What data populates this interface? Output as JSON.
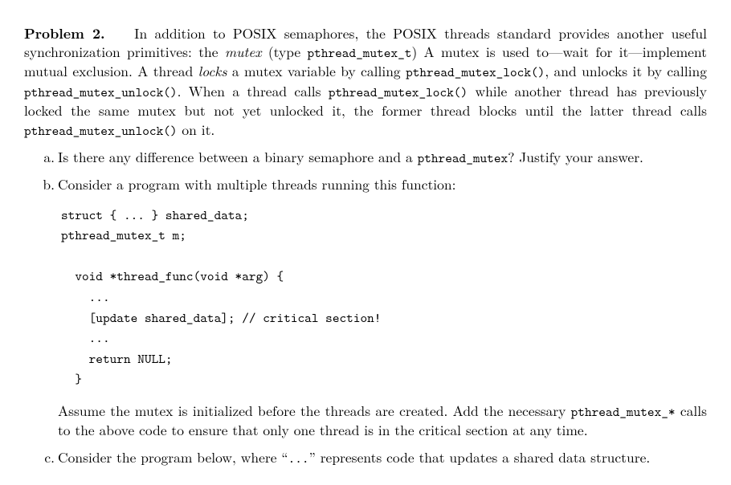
{
  "problem": {
    "label": "Problem 2.",
    "lead_in": "In addition to POSIX semaphores, the POSIX threads standard provides another useful synchronization primitives: the ",
    "mutex_word": "mutex",
    "after_mutex": " (type ",
    "type_code": "pthread_mutex_t",
    "after_type": ") A mutex is used to—wait for it—implement mutual exclusion. A thread ",
    "locks_word": "locks",
    "after_locks": " a mutex variable by calling ",
    "lock_call": "pthread_mutex_lock()",
    "after_lockcall": ", and unlocks it by calling ",
    "unlock_call": "pthread_mutex_unlock()",
    "after_unlock": ". When a thread calls ",
    "lock_call2": "pthread_mutex_lock()",
    "after_lock2": " while another thread has previously locked the same mutex but not yet unlocked it, the former thread blocks until the latter thread calls ",
    "unlock_call2": "pthread_mutex_unlock()",
    "tail": " on it."
  },
  "parts": {
    "a": {
      "marker": "a.",
      "before_code": "Is there any difference between a binary semaphore and a ",
      "code": "pthread_mutex",
      "after_code": "? Justify your answer."
    },
    "b": {
      "marker": "b.",
      "intro": "Consider a program with multiple threads running this function:",
      "code": "struct { ... } shared_data;\npthread_mutex_t m;\n\n  void *thread_func(void *arg) {\n    ...\n    [update shared_data]; // critical section!\n    ...\n    return NULL;\n  }",
      "para_before": "Assume the mutex is initialized before the threads are created. Add the necessary ",
      "para_code": "pthread_mutex_*",
      "para_after": " calls to the above code to ensure that only one thread is in the critical section at any time."
    },
    "c": {
      "marker": "c.",
      "before": "Consider the program below, where “",
      "dots_code": "...",
      "after": "” represents code that updates a shared data structure."
    }
  }
}
